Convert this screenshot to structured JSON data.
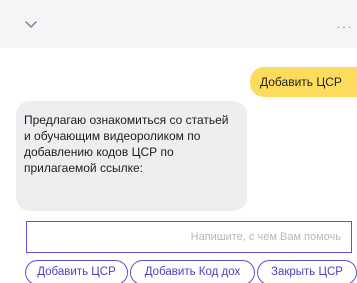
{
  "header": {
    "collapse_icon": "chevron-down-icon",
    "menu_icon": "more-dots-icon",
    "menu_glyph": "···"
  },
  "messages": [
    {
      "from": "user",
      "text": "Добавить ЦСР"
    },
    {
      "from": "bot",
      "lines": [
        "Предлагаю ознакомиться со статьей",
        "и обучающим видеороликом по",
        "добавлению кодов ЦСР по",
        "прилагаемой ссылке:"
      ]
    }
  ],
  "composer": {
    "placeholder": "Напишите, с чем Вам помочь",
    "value": ""
  },
  "quick_replies": [
    "Добавить ЦСР",
    "Добавить Код дох",
    "Закрыть ЦСР"
  ],
  "colors": {
    "accent": "#5b52d6",
    "user_bubble": "#fddb5c",
    "bot_bubble": "#eeeef1",
    "header_bg": "#f5f5f7"
  }
}
